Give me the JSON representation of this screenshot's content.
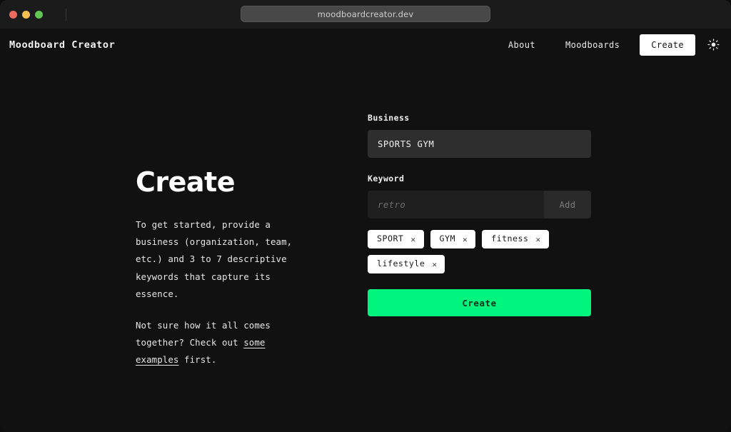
{
  "browser": {
    "url": "moodboardcreator.dev",
    "traffic_lights": [
      "close-red",
      "minimize-yellow",
      "maximize-green"
    ]
  },
  "header": {
    "brand": "Moodboard Creator",
    "nav": [
      {
        "label": "About",
        "name": "nav-about"
      },
      {
        "label": "Moodboards",
        "name": "nav-moodboards"
      }
    ],
    "cta": "Create",
    "theme_toggle_icon": "sun-icon"
  },
  "intro": {
    "title": "Create",
    "paragraph1": "To get started, provide a business (organization, team, etc.) and 3 to 7 descriptive keywords that capture its essence.",
    "paragraph2_before": "Not sure how it all comes together? Check out ",
    "paragraph2_link": "some examples",
    "paragraph2_after": " first."
  },
  "form": {
    "business": {
      "label": "Business",
      "value": "SPORTS GYM",
      "placeholder": ""
    },
    "keyword": {
      "label": "Keyword",
      "value": "",
      "placeholder": "retro",
      "add_label": "Add"
    },
    "chips": [
      {
        "label": "SPORT",
        "remove_icon": "close-icon"
      },
      {
        "label": "GYM",
        "remove_icon": "close-icon"
      },
      {
        "label": "fitness",
        "remove_icon": "close-icon"
      },
      {
        "label": "lifestyle",
        "remove_icon": "close-icon"
      }
    ],
    "submit_label": "Create"
  },
  "colors": {
    "background": "#111111",
    "accent_green": "#00f57f",
    "input_fill": "#2e2e2e",
    "chip_fill": "#ffffff"
  }
}
